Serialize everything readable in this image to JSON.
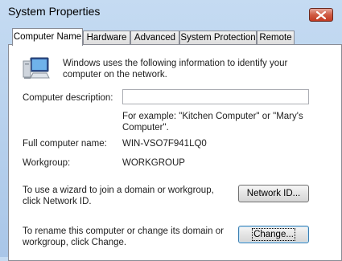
{
  "window": {
    "title": "System Properties"
  },
  "tabs": [
    {
      "label": "Computer Name",
      "active": true
    },
    {
      "label": "Hardware"
    },
    {
      "label": "Advanced"
    },
    {
      "label": "System Protection"
    },
    {
      "label": "Remote"
    }
  ],
  "intro": "Windows uses the following information to identify your computer on the network.",
  "description": {
    "label": "Computer description:",
    "value": "",
    "hint": "For example: \"Kitchen Computer\" or \"Mary's Computer\"."
  },
  "full_name": {
    "label": "Full computer name:",
    "value": "WIN-VSO7F941LQ0"
  },
  "workgroup": {
    "label": "Workgroup:",
    "value": "WORKGROUP"
  },
  "network_id": {
    "text": "To use a wizard to join a domain or workgroup, click Network ID.",
    "button": "Network ID..."
  },
  "change": {
    "text": "To rename this computer or change its domain or workgroup, click Change.",
    "button": "Change..."
  },
  "colors": {
    "close": "#c23a22",
    "focus_border": "#3c7fb1"
  }
}
